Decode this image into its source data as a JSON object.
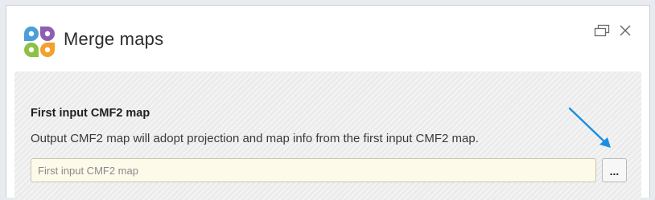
{
  "window": {
    "title": "Merge maps",
    "icons": {
      "app": "clover-app-icon",
      "restore": "restore-window-icon",
      "close": "close-icon"
    }
  },
  "content": {
    "section_title": "First input CMF2 map",
    "description": "Output CMF2 map will adopt projection and map info from the first input CMF2 map.",
    "input": {
      "value": "",
      "placeholder": "First input CMF2 map"
    },
    "browse_label": "..."
  },
  "colors": {
    "icon_blue": "#4a9fd8",
    "icon_purple": "#8e5fb0",
    "icon_green": "#8ec045",
    "icon_orange": "#f2a12d",
    "arrow": "#1a8fe0",
    "input_bg": "#fdfaea"
  }
}
